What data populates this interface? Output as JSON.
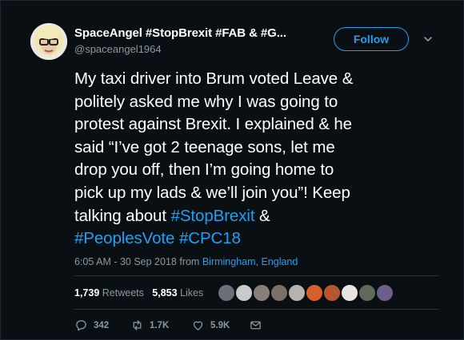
{
  "author": {
    "display_name": "SpaceAngel #StopBrexit #FAB & #G...",
    "handle": "@spaceangel1964"
  },
  "follow_label": "Follow",
  "tweet_lines": [
    [
      {
        "t": "My taxi driver into Brum voted Leave &"
      }
    ],
    [
      {
        "t": "politely asked me why I was going to"
      }
    ],
    [
      {
        "t": "protest against Brexit. I explained & he"
      }
    ],
    [
      {
        "t": "said “I’ve got 2 teenage sons, let me"
      }
    ],
    [
      {
        "t": "drop you off, then I’m going home to"
      }
    ],
    [
      {
        "t": "pick up my lads & we’ll join you”! Keep"
      }
    ],
    [
      {
        "t": "talking about "
      },
      {
        "t": "#StopBrexit",
        "tag": true
      },
      {
        "t": " &"
      }
    ],
    [
      {
        "t": "#PeoplesVote",
        "tag": true
      },
      {
        "t": " "
      },
      {
        "t": "#CPC18",
        "tag": true
      }
    ]
  ],
  "meta": {
    "time_date": "6:05 AM - 30 Sep 2018 from ",
    "location": "Birmingham, England"
  },
  "stats": {
    "retweets_count": "1,739",
    "retweets_label": "Retweets",
    "likes_count": "5,853",
    "likes_label": "Likes"
  },
  "liker_avatars": [
    {
      "name": "liker-avatar-1",
      "color": "#6b6f7a"
    },
    {
      "name": "liker-avatar-2",
      "color": "#c9c9c9"
    },
    {
      "name": "liker-avatar-3",
      "color": "#8a7f78"
    },
    {
      "name": "liker-avatar-4",
      "color": "#7d6f64"
    },
    {
      "name": "liker-avatar-5",
      "color": "#b7b2ad"
    },
    {
      "name": "liker-avatar-6",
      "color": "#d5602a"
    },
    {
      "name": "liker-avatar-7",
      "color": "#b5562f"
    },
    {
      "name": "liker-avatar-8",
      "color": "#e9e6e2"
    },
    {
      "name": "liker-avatar-9",
      "color": "#5f6a5a"
    },
    {
      "name": "liker-avatar-10",
      "color": "#6c5f8a"
    }
  ],
  "actions": {
    "replies": "342",
    "retweets": "1.7K",
    "likes": "5.9K"
  },
  "colors": {
    "accent": "#1da1f2",
    "background": "#0a0f14",
    "secondary_text": "#8899a6"
  }
}
